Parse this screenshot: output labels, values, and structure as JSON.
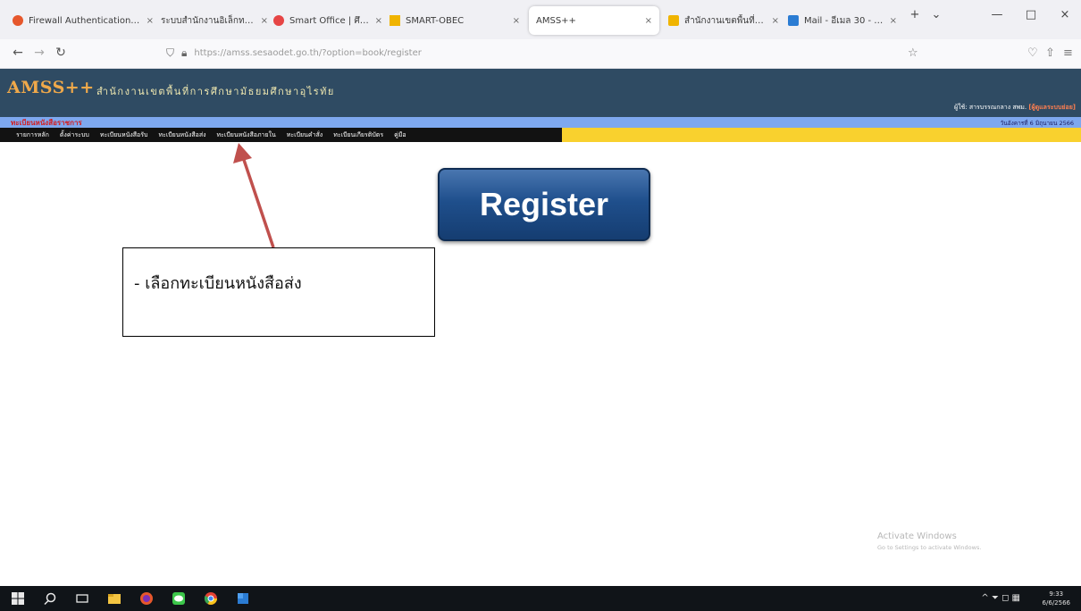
{
  "browser": {
    "tabs": [
      {
        "title": "Firewall Authentication Ke...",
        "icon": "firefox-icon",
        "color": "#e6572c",
        "close": "×",
        "left": 0
      },
      {
        "title": "ระบบสำนักงานอิเล็กทรอนิกส์ ...",
        "icon": "page-icon",
        "color": "#9a9a9a",
        "close": "×"
      },
      {
        "title": "Smart Office | ศึกษาธิการ...",
        "icon": "smart-office-icon",
        "color": "#e64545",
        "close": "×"
      },
      {
        "title": "SMART-OBEC",
        "icon": "smart-obec-icon",
        "color": "#f0b400",
        "close": "×"
      },
      {
        "title": "AMSS++",
        "icon": "page-icon",
        "color": "#9a9a9a",
        "close": "×",
        "active": true
      },
      {
        "title": "สำนักงานเขตพื้นที่การศึกษา...",
        "icon": "office-icon",
        "color": "#f0b400",
        "close": "×"
      },
      {
        "title": "Mail - อีเมล 30 - Outlook",
        "icon": "outlook-icon",
        "color": "#2b7cd3",
        "close": "×"
      }
    ],
    "new_tab": "+",
    "tab_list": "⌄",
    "window_controls": {
      "minimize": "—",
      "maximize": "□",
      "close": "×"
    },
    "nav": {
      "back": "←",
      "forward": "→",
      "reload": "↻"
    },
    "url": "https://amss.sesaodet.go.th/?option=book/register",
    "toolbar_icons": {
      "star": "☆",
      "pocket": "♡",
      "extensions": "⇧",
      "menu": "≡"
    }
  },
  "site": {
    "logo": "AMSS++",
    "org_name": "สำนักงานเขตพื้นที่การศึกษามัธยมศึกษาอุไรทัย",
    "user_label": "ผู้ใช้: สารบรรณกลาง สพม.",
    "user_role": "[ผู้ดูแลระบบย่อย]",
    "section_title": "ทะเบียนหนังสือราชการ",
    "date": "วันอังคารที่ 6 มิถุนายน 2566",
    "menu": [
      "รายการหลัก",
      "ตั้งค่าระบบ",
      "ทะเบียนหนังสือรับ",
      "ทะเบียนหนังสือส่ง",
      "ทะเบียนหนังสือภายใน",
      "ทะเบียนคำสั่ง",
      "ทะเบียนเกียรติบัตร",
      "คู่มือ"
    ]
  },
  "main": {
    "register_label": "Register"
  },
  "annotation": {
    "text": "- เลือกทะเบียนหนังสือส่ง",
    "arrow_color": "#c0504d"
  },
  "watermark": {
    "title": "Activate Windows",
    "subtitle": "Go to Settings to activate Windows."
  },
  "taskbar": {
    "tray": "^ ⏷ ◻ ▦",
    "time": "9:33",
    "date": "6/6/2566"
  }
}
